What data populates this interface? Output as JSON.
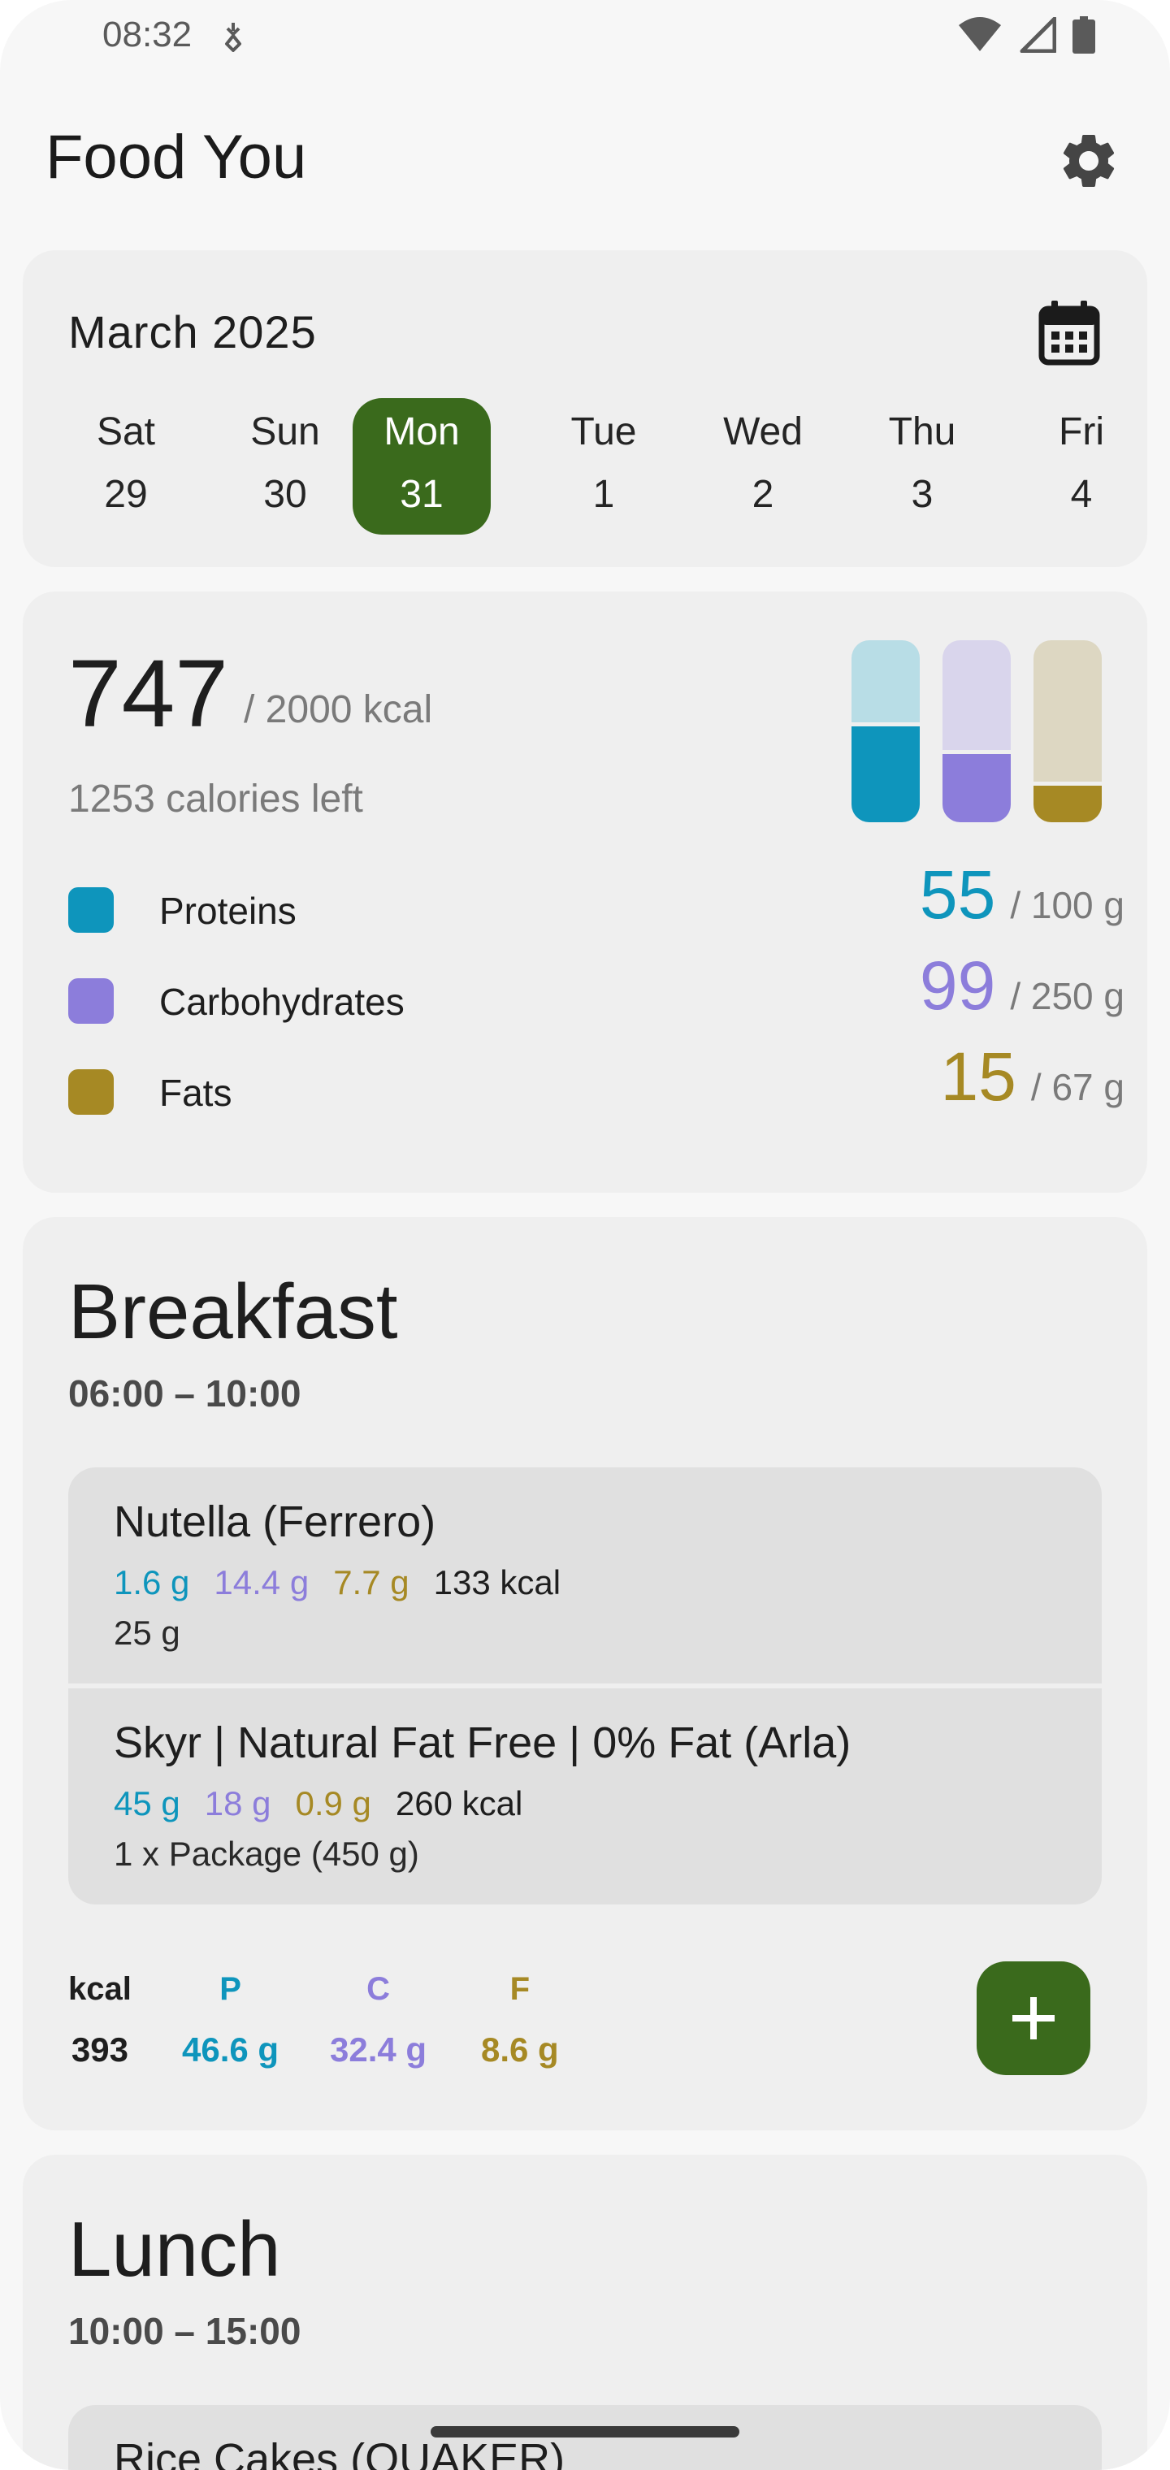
{
  "status_bar": {
    "time": "08:32"
  },
  "app": {
    "title": "Food You"
  },
  "calendar": {
    "month": "March 2025",
    "days": [
      {
        "name": "Sat",
        "date": "29"
      },
      {
        "name": "Sun",
        "date": "30"
      },
      {
        "name": "Mon",
        "date": "31"
      },
      {
        "name": "Tue",
        "date": "1"
      },
      {
        "name": "Wed",
        "date": "2"
      },
      {
        "name": "Thu",
        "date": "3"
      },
      {
        "name": "Fri",
        "date": "4"
      }
    ],
    "selected_day": "Mon 31"
  },
  "summary": {
    "calories": "747",
    "calories_goal": "/ 2000 kcal",
    "calories_left": "1253 calories left",
    "macros": [
      {
        "name": "Proteins",
        "value": "55",
        "goal": "/ 100 g",
        "color": "#0e95bc",
        "track_color": "#b8dde6",
        "progress": 0.55
      },
      {
        "name": "Carbohydrates",
        "value": "99",
        "goal": "/ 250 g",
        "color": "#8c7ddb",
        "track_color": "#d9d5ec",
        "progress": 0.396
      },
      {
        "name": "Fats",
        "value": "15",
        "goal": "/ 67 g",
        "color": "#a68924",
        "track_color": "#ddd7c2",
        "progress": 0.224
      }
    ]
  },
  "meals": {
    "breakfast": {
      "title": "Breakfast",
      "time": "06:00 – 10:00",
      "items": [
        {
          "name": "Nutella (Ferrero)",
          "protein": "1.6 g",
          "carbs": "14.4 g",
          "fat": "7.7 g",
          "kcal": "133 kcal",
          "quantity": "25 g"
        },
        {
          "name": "Skyr | Natural Fat Free | 0% Fat (Arla)",
          "protein": "45 g",
          "carbs": "18 g",
          "fat": "0.9 g",
          "kcal": "260 kcal",
          "quantity": "1 x Package (450 g)"
        }
      ],
      "totals": {
        "kcal_label": "kcal",
        "kcal": "393",
        "protein_label": "P",
        "protein": "46.6 g",
        "carbs_label": "C",
        "carbs": "32.4 g",
        "fat_label": "F",
        "fat": "8.6 g"
      }
    },
    "lunch": {
      "title": "Lunch",
      "time": "10:00 – 15:00",
      "first_item": "Rice Cakes (QUAKER)"
    }
  },
  "colors": {
    "accent": "#3a6a1c",
    "protein": "#0e95bc",
    "carbs": "#8c7ddb",
    "fat": "#a68924"
  },
  "icons": [
    "settings-icon",
    "calendar-icon",
    "plus-icon",
    "wifi-icon",
    "signal-icon",
    "battery-icon",
    "data-saver-icon"
  ]
}
